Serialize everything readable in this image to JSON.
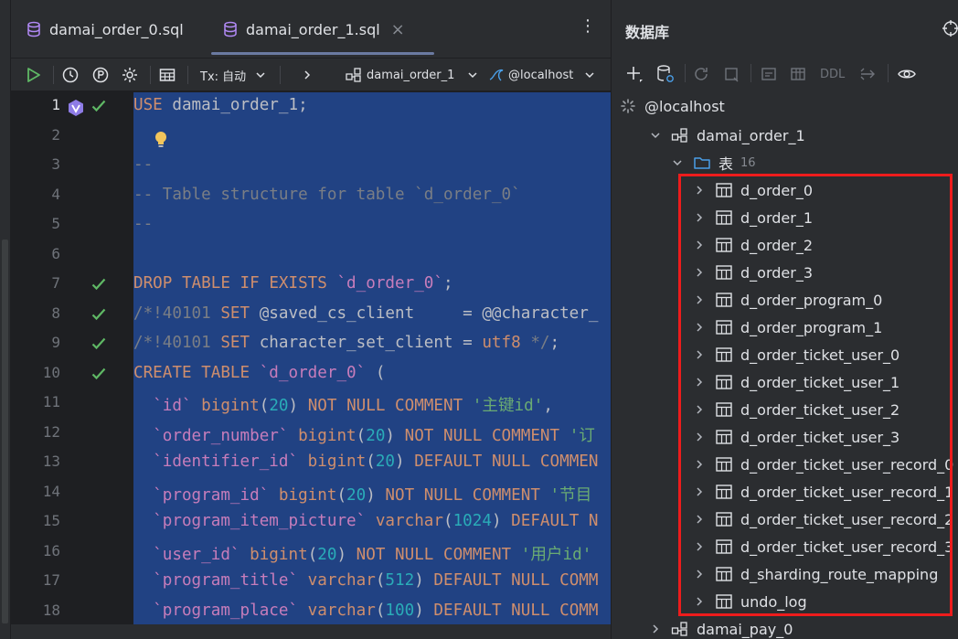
{
  "tabs": [
    {
      "label": "damai_order_0.sql",
      "active": false
    },
    {
      "label": "damai_order_1.sql",
      "active": true,
      "close": "×"
    }
  ],
  "tab_menu": "⋮",
  "toolbar": {
    "tx_label": "Tx: 自动",
    "schema": "damai_order_1",
    "datasource": "@localhost"
  },
  "line_numbers": [
    "1",
    "2",
    "3",
    "4",
    "5",
    "6",
    "7",
    "8",
    "9",
    "10",
    "11",
    "12",
    "13",
    "14",
    "15",
    "16",
    "17",
    "18"
  ],
  "code_lines": [
    "USE damai_order_1;",
    "",
    "--",
    "-- Table structure for table `d_order_0`",
    "--",
    "",
    "DROP TABLE IF EXISTS `d_order_0`;",
    "/*!40101 SET @saved_cs_client     = @@character_",
    "/*!40101 SET character_set_client = utf8 */;",
    "CREATE TABLE `d_order_0` (",
    "  `id` bigint(20) NOT NULL COMMENT '主键id',",
    "  `order_number` bigint(20) NOT NULL COMMENT '订",
    "  `identifier_id` bigint(20) DEFAULT NULL COMMEN",
    "  `program_id` bigint(20) NOT NULL COMMENT '节目",
    "  `program_item_picture` varchar(1024) DEFAULT N",
    "  `user_id` bigint(20) NOT NULL COMMENT '用户id'",
    "  `program_title` varchar(512) DEFAULT NULL COMM",
    "  `program_place` varchar(100) DEFAULT NULL COMM"
  ],
  "db_panel": {
    "title": "数据库",
    "ddl_label": "DDL",
    "host": "@localhost",
    "schema": "damai_order_1",
    "tables_folder": "表",
    "tables_count": "16",
    "tables": [
      "d_order_0",
      "d_order_1",
      "d_order_2",
      "d_order_3",
      "d_order_program_0",
      "d_order_program_1",
      "d_order_ticket_user_0",
      "d_order_ticket_user_1",
      "d_order_ticket_user_2",
      "d_order_ticket_user_3",
      "d_order_ticket_user_record_0",
      "d_order_ticket_user_record_1",
      "d_order_ticket_user_record_2",
      "d_order_ticket_user_record_3",
      "d_sharding_route_mapping",
      "undo_log"
    ],
    "next_schema": "damai_pay_0"
  },
  "colors": {
    "highlight_box": "#ee1c1c",
    "selection": "#214283",
    "keyword": "#cf8e6d",
    "comment": "#7a7e85",
    "string": "#6aab73",
    "number": "#2aacb8",
    "identifier": "#c77dbb",
    "check": "#5fb865"
  }
}
